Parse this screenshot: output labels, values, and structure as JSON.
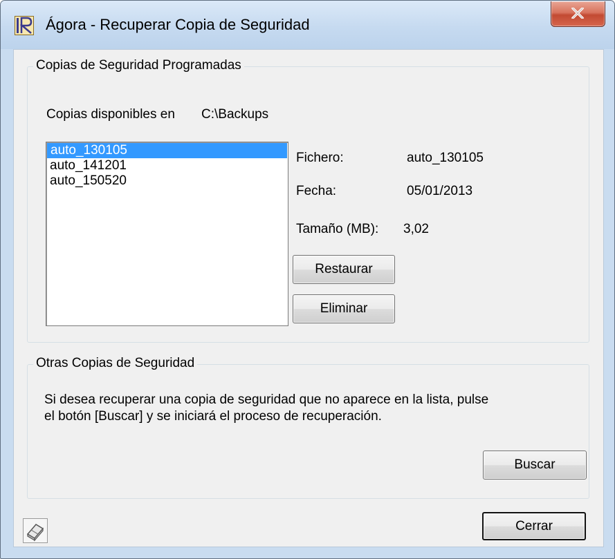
{
  "window": {
    "title": "Ágora - Recuperar Copia de Seguridad",
    "app_icon": "agora-app-icon",
    "close_icon": "close-icon",
    "accent_close_color": "#c24a32"
  },
  "scheduled": {
    "legend": "Copias de Seguridad Programadas",
    "available_label": "Copias disponibles en",
    "available_path": "C:\\Backups",
    "list": [
      {
        "name": "auto_130105",
        "selected": true
      },
      {
        "name": "auto_141201",
        "selected": false
      },
      {
        "name": "auto_150520",
        "selected": false
      }
    ],
    "details": {
      "file_label": "Fichero:",
      "file_value": "auto_130105",
      "date_label": "Fecha:",
      "date_value": "05/01/2013",
      "size_label": "Tamaño (MB):",
      "size_value": "3,02"
    },
    "restore_label": "Restaurar",
    "delete_label": "Eliminar"
  },
  "other": {
    "legend": "Otras Copias de Seguridad",
    "line1": "Si desea recuperar una copia de seguridad que no aparece en la lista, pulse",
    "line2": "el botón [Buscar] y se iniciará el proceso de recuperación.",
    "search_label": "Buscar"
  },
  "footer": {
    "eraser_icon": "eraser-icon",
    "close_label": "Cerrar"
  },
  "colors": {
    "selection": "#3399ff",
    "titlebar": "#c6daf0",
    "dialog_bg": "#f0f0f0"
  }
}
